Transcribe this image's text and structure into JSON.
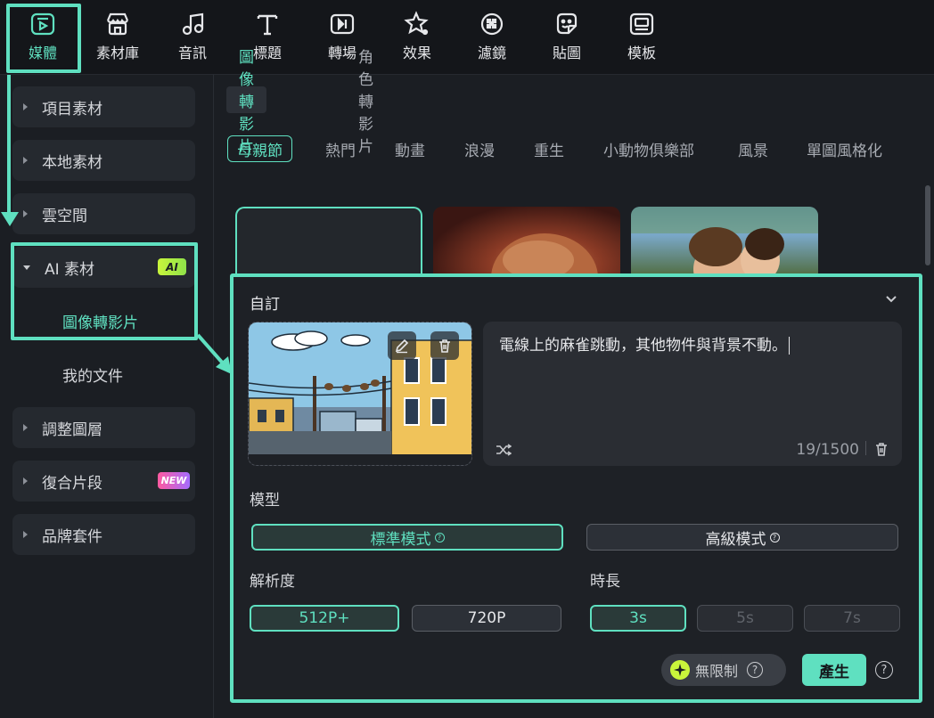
{
  "toolbar": {
    "items": [
      {
        "label": "媒體",
        "icon": "media-icon"
      },
      {
        "label": "素材庫",
        "icon": "store-icon"
      },
      {
        "label": "音訊",
        "icon": "music-icon"
      },
      {
        "label": "標題",
        "icon": "text-icon"
      },
      {
        "label": "轉場",
        "icon": "transition-icon"
      },
      {
        "label": "效果",
        "icon": "effects-icon"
      },
      {
        "label": "濾鏡",
        "icon": "filter-icon"
      },
      {
        "label": "貼圖",
        "icon": "sticker-icon"
      },
      {
        "label": "模板",
        "icon": "template-icon"
      }
    ]
  },
  "sidebar": {
    "items": [
      {
        "label": "項目素材"
      },
      {
        "label": "本地素材"
      },
      {
        "label": "雲空間"
      },
      {
        "label": "AI 素材",
        "badge": "AI"
      },
      {
        "label": "調整圖層"
      },
      {
        "label": "復合片段",
        "badge": "NEW"
      },
      {
        "label": "品牌套件"
      }
    ],
    "subitems": [
      {
        "label": "圖像轉影片"
      },
      {
        "label": "我的文件"
      }
    ]
  },
  "tabs": [
    {
      "label": "圖像轉影片"
    },
    {
      "label": "角色轉影片"
    }
  ],
  "categories": [
    "母親節",
    "熱門",
    "動畫",
    "浪漫",
    "重生",
    "小動物俱樂部",
    "風景",
    "單圖風格化"
  ],
  "panel": {
    "title": "自訂",
    "prompt": "電線上的麻雀跳動，其他物件與背景不動。",
    "counter": "19/1500",
    "model_label": "模型",
    "model_standard": "標準模式",
    "model_advanced": "高級模式",
    "resolution_label": "解析度",
    "res_512": "512P+",
    "res_720": "720P",
    "duration_label": "時長",
    "dur_3": "3s",
    "dur_5": "5s",
    "dur_7": "7s",
    "unlimited": "無限制",
    "generate": "產生"
  },
  "colors": {
    "accent": "#5fe0c0",
    "background": "#1b1e23"
  }
}
